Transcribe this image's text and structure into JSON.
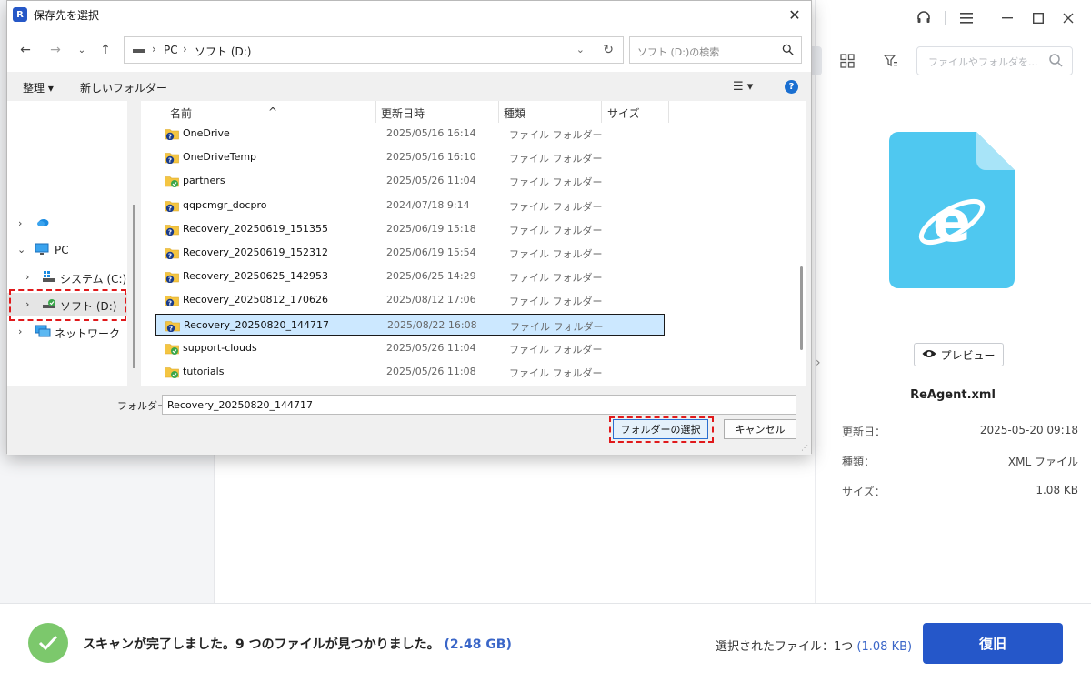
{
  "dialog": {
    "title": "保存先を選択",
    "address": {
      "crumbs": [
        "PC",
        "ソフト (D:)"
      ]
    },
    "search_placeholder": "ソフト (D:)の検索",
    "organize_label": "整理 ▾",
    "new_folder_label": "新しいフォルダー",
    "columns": {
      "name": "名前",
      "modified": "更新日時",
      "type": "種類",
      "size": "サイズ"
    },
    "nav_tree": [
      {
        "label": "",
        "icon": "onedrive-cloud-icon",
        "expander": "›"
      },
      {
        "label": "PC",
        "icon": "pc-monitor-icon",
        "expander": "⌄"
      },
      {
        "label": "システム (C:)",
        "icon": "windows-drive-icon",
        "expander": "›"
      },
      {
        "label": "ソフト (D:)",
        "icon": "drive-d-icon",
        "expander": "›"
      },
      {
        "label": "ネットワーク",
        "icon": "network-icon",
        "expander": "›"
      }
    ],
    "files": [
      {
        "name": "OneDrive",
        "modified": "2025/05/16 16:14",
        "type": "ファイル フォルダー",
        "status": "unknown"
      },
      {
        "name": "OneDriveTemp",
        "modified": "2025/05/16 16:10",
        "type": "ファイル フォルダー",
        "status": "unknown"
      },
      {
        "name": "partners",
        "modified": "2025/05/26 11:04",
        "type": "ファイル フォルダー",
        "status": "synced"
      },
      {
        "name": "qqpcmgr_docpro",
        "modified": "2024/07/18 9:14",
        "type": "ファイル フォルダー",
        "status": "unknown"
      },
      {
        "name": "Recovery_20250619_151355",
        "modified": "2025/06/19 15:18",
        "type": "ファイル フォルダー",
        "status": "unknown"
      },
      {
        "name": "Recovery_20250619_152312",
        "modified": "2025/06/19 15:54",
        "type": "ファイル フォルダー",
        "status": "unknown"
      },
      {
        "name": "Recovery_20250625_142953",
        "modified": "2025/06/25 14:29",
        "type": "ファイル フォルダー",
        "status": "unknown"
      },
      {
        "name": "Recovery_20250812_170626",
        "modified": "2025/08/12 17:06",
        "type": "ファイル フォルダー",
        "status": "unknown"
      },
      {
        "name": "Recovery_20250820_144717",
        "modified": "2025/08/22 16:08",
        "type": "ファイル フォルダー",
        "status": "unknown",
        "selected": true
      },
      {
        "name": "support-clouds",
        "modified": "2025/05/26 11:04",
        "type": "ファイル フォルダー",
        "status": "synced"
      },
      {
        "name": "tutorials",
        "modified": "2025/05/26 11:08",
        "type": "ファイル フォルダー",
        "status": "synced"
      }
    ],
    "folder_label": "フォルダー:",
    "folder_value": "Recovery_20250820_144717",
    "select_folder_label": "フォルダーの選択",
    "cancel_label": "キャンセル"
  },
  "app": {
    "search_placeholder": "ファイルやフォルダを...",
    "preview_label": "プレビュー",
    "file_name": "ReAgent.xml",
    "meta": [
      {
        "key": "更新日：",
        "value": "2025-05-20 09:18"
      },
      {
        "key": "種類：",
        "value": "XML ファイル"
      },
      {
        "key": "サイズ：",
        "value": "1.08 KB"
      }
    ],
    "scan_message": "スキャンが完了しました。9 つのファイルが見つかりました。",
    "scan_size": "(2.48 GB)",
    "selected_label": "選択されたファイル：1つ",
    "selected_size": "(1.08 KB)",
    "recover_label": "復旧",
    "colors": {
      "accent": "#2557c9",
      "success": "#7cc86c",
      "file_icon": "#4fc8f0",
      "highlight": "#e0191b"
    }
  }
}
